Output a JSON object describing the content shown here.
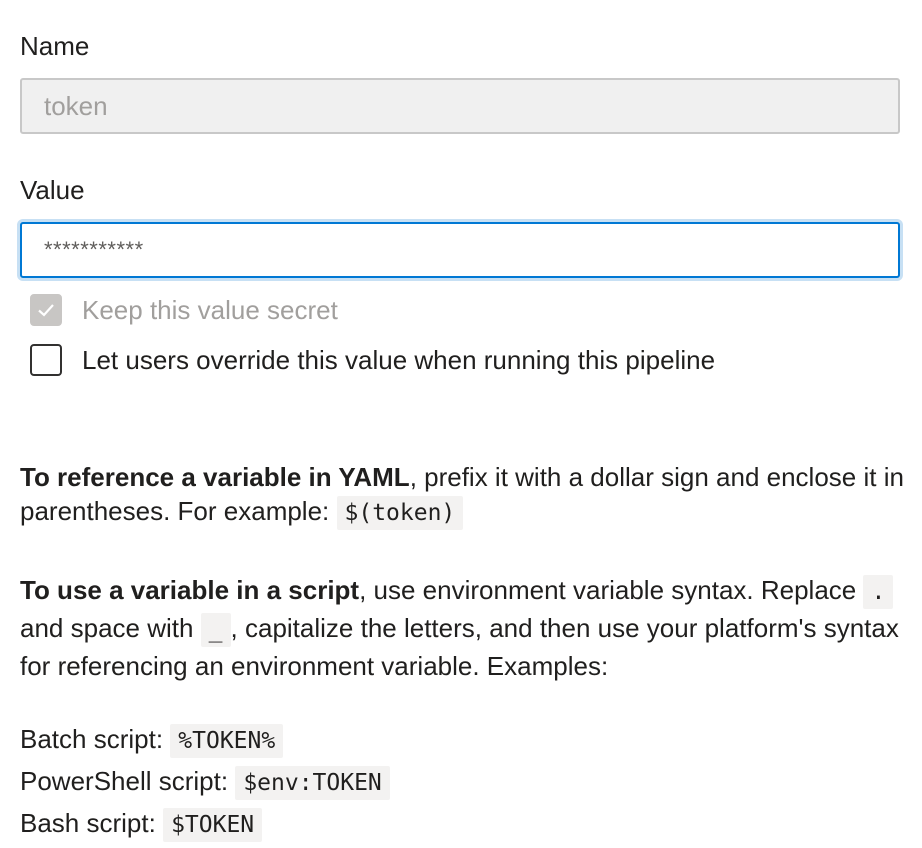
{
  "name_field": {
    "label": "Name",
    "value": "token"
  },
  "value_field": {
    "label": "Value",
    "value": "***********"
  },
  "checkboxes": {
    "secret": {
      "label": "Keep this value secret",
      "checked": true,
      "disabled": true
    },
    "override": {
      "label": "Let users override this value when running this pipeline",
      "checked": false,
      "disabled": false
    }
  },
  "yaml_help": {
    "bold": "To reference a variable in YAML",
    "text": ", prefix it with a dollar sign and enclose it in parentheses. For example: ",
    "code": "$(token)"
  },
  "script_help": {
    "bold": "To use a variable in a script",
    "text1": ", use environment variable syntax. Replace ",
    "code_dot": ".",
    "text2": " and space with ",
    "code_underscore": "_",
    "text3": ", capitalize the letters, and then use your platform's syntax for referencing an environment variable. Examples:"
  },
  "examples": [
    {
      "label": "Batch script: ",
      "code": "%TOKEN%"
    },
    {
      "label": "PowerShell script: ",
      "code": "$env:TOKEN"
    },
    {
      "label": "Bash script: ",
      "code": "$TOKEN"
    }
  ],
  "colors": {
    "focus_border": "#0078d4",
    "disabled_bg": "#f0f0f0",
    "code_bg": "#f3f2f1"
  },
  "icons": {
    "secret_checkbox": "checkmark-icon"
  }
}
